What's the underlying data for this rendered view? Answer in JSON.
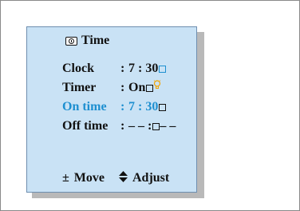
{
  "menu": {
    "title": "Time",
    "rows": [
      {
        "label": "Clock",
        "colon": ":",
        "value": "7 : 30"
      },
      {
        "label": "Timer",
        "colon": ":",
        "value": "On"
      },
      {
        "label": "On time",
        "colon": ":",
        "value": "7 : 30"
      },
      {
        "label": "Off time",
        "colon": ":",
        "value": "– – :",
        "value_after": "– –"
      }
    ],
    "footer": {
      "move_icon": "±",
      "move_label": "Move",
      "adjust_icon": "▲▼",
      "adjust_label": "Adjust"
    }
  },
  "colors": {
    "osd_background": "#c9e2f5",
    "highlight": "#1d8fd0",
    "bulb": "#f2a400"
  },
  "icons": [
    "clock-icon",
    "bulb-icon",
    "plus-minus-icon",
    "up-down-arrows-icon"
  ]
}
